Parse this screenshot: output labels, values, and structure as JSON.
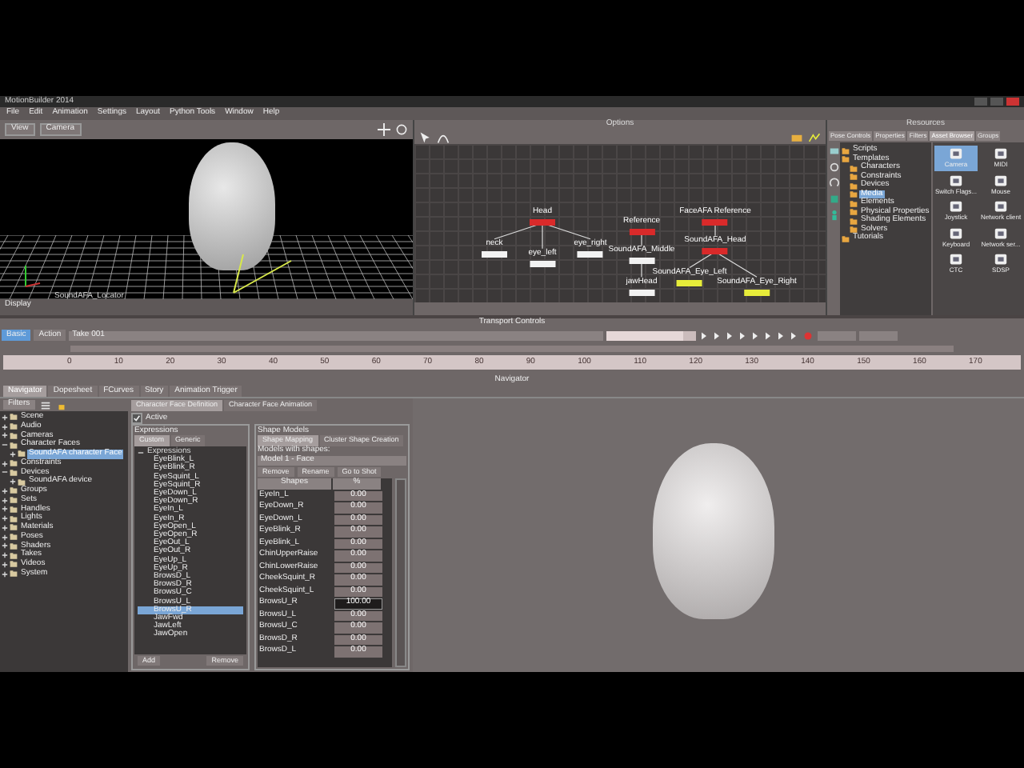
{
  "window": {
    "title": "MotionBuilder 2014"
  },
  "menu": [
    "File",
    "Edit",
    "Animation",
    "Settings",
    "Layout",
    "Python Tools",
    "Window",
    "Help"
  ],
  "viewer": {
    "buttons": [
      "View",
      "Camera"
    ],
    "object_label": "SoundAFA_Locator",
    "status": "Display"
  },
  "schematic": {
    "title": "Options",
    "nodes": [
      {
        "label": "Head",
        "kind": "red",
        "children": [
          {
            "label": "neck",
            "kind": "white"
          },
          {
            "label": "eye_left",
            "kind": "white"
          },
          {
            "label": "eye_right",
            "kind": "white"
          }
        ]
      },
      {
        "label": "Reference",
        "kind": "red",
        "children": [
          {
            "label": "SoundAFA_Middle",
            "kind": "white",
            "children": [
              {
                "label": "jawHead",
                "kind": "white"
              }
            ]
          }
        ]
      },
      {
        "label": "FaceAFA Reference",
        "kind": "red",
        "children": [
          {
            "label": "SoundAFA_Head",
            "kind": "red",
            "children": [
              {
                "label": "SoundAFA_Eye_Left",
                "kind": "yellow"
              },
              {
                "label": "SoundAFA_Eye_Right",
                "kind": "yellow"
              }
            ]
          }
        ]
      }
    ]
  },
  "resources": {
    "title": "Resources",
    "tabs": [
      {
        "label": "Pose Controls",
        "selected": false
      },
      {
        "label": "Properties",
        "selected": false
      },
      {
        "label": "Filters",
        "selected": false
      },
      {
        "label": "Asset Browser",
        "selected": true
      },
      {
        "label": "Groups",
        "selected": false
      }
    ],
    "tree": [
      {
        "label": "Scripts",
        "selected": false
      },
      {
        "label": "Templates",
        "selected": false,
        "children": [
          {
            "label": "Characters",
            "selected": false
          },
          {
            "label": "Constraints",
            "selected": false
          },
          {
            "label": "Devices",
            "selected": false
          },
          {
            "label": "Media",
            "selected": true
          },
          {
            "label": "Elements",
            "selected": false
          },
          {
            "label": "Physical Properties",
            "selected": false
          },
          {
            "label": "Shading Elements",
            "selected": false
          },
          {
            "label": "Solvers",
            "selected": false
          }
        ]
      },
      {
        "label": "Tutorials",
        "selected": false
      }
    ],
    "assets": [
      {
        "label": "Camera",
        "selected": true
      },
      {
        "label": "MIDI",
        "selected": false
      },
      {
        "label": "Switch Flags...",
        "selected": false
      },
      {
        "label": "Mouse",
        "selected": false
      },
      {
        "label": "Joystick",
        "selected": false
      },
      {
        "label": "Network client",
        "selected": false
      },
      {
        "label": "Keyboard",
        "selected": false
      },
      {
        "label": "Network ser...",
        "selected": false
      },
      {
        "label": "CTC",
        "selected": false
      },
      {
        "label": "SDSP",
        "selected": false
      }
    ]
  },
  "transport": {
    "title": "Transport Controls",
    "modes": [
      {
        "label": "Basic",
        "selected": true
      },
      {
        "label": "Action",
        "selected": false
      }
    ],
    "take": "Take 001",
    "speed": {
      "level": 0.85
    },
    "ruler": [
      "0",
      "10",
      "20",
      "30",
      "40",
      "50",
      "60",
      "70",
      "80",
      "90",
      "100",
      "110",
      "120",
      "130",
      "140",
      "150",
      "160",
      "170"
    ]
  },
  "navigator": {
    "title": "Navigator",
    "tabs": [
      {
        "label": "Navigator",
        "selected": true
      },
      {
        "label": "Dopesheet",
        "selected": false
      },
      {
        "label": "FCurves",
        "selected": false
      },
      {
        "label": "Story",
        "selected": false
      },
      {
        "label": "Animation Trigger",
        "selected": false
      }
    ],
    "filter": "Filters",
    "tree": [
      {
        "label": "Scene",
        "selected": false
      },
      {
        "label": "Audio",
        "selected": false
      },
      {
        "label": "Cameras",
        "selected": false
      },
      {
        "label": "Character Faces",
        "selected": false,
        "children": [
          {
            "label": "SoundAFA character Face",
            "selected": true
          }
        ]
      },
      {
        "label": "Constraints",
        "selected": false
      },
      {
        "label": "Devices",
        "selected": false,
        "children": [
          {
            "label": "SoundAFA device",
            "selected": false
          }
        ]
      },
      {
        "label": "Groups",
        "selected": false
      },
      {
        "label": "Sets",
        "selected": false
      },
      {
        "label": "Handles",
        "selected": false
      },
      {
        "label": "Lights",
        "selected": false
      },
      {
        "label": "Materials",
        "selected": false
      },
      {
        "label": "Poses",
        "selected": false
      },
      {
        "label": "Shaders",
        "selected": false
      },
      {
        "label": "Takes",
        "selected": false
      },
      {
        "label": "Videos",
        "selected": false
      },
      {
        "label": "System",
        "selected": false
      }
    ]
  },
  "face": {
    "tabs": [
      {
        "label": "Character Face Definition",
        "selected": true
      },
      {
        "label": "Character Face Animation",
        "selected": false
      }
    ],
    "active": {
      "label": "Active",
      "checked": true
    },
    "expressions": {
      "title": "Expressions",
      "tabs": [
        {
          "label": "Custom",
          "selected": true
        },
        {
          "label": "Generic",
          "selected": false
        }
      ],
      "heading": "Expressions",
      "items": [
        {
          "label": "EyeBlink_L",
          "selected": false
        },
        {
          "label": "EyeBlink_R",
          "selected": false
        },
        {
          "label": "EyeSquint_L",
          "selected": false
        },
        {
          "label": "EyeSquint_R",
          "selected": false
        },
        {
          "label": "EyeDown_L",
          "selected": false
        },
        {
          "label": "EyeDown_R",
          "selected": false
        },
        {
          "label": "EyeIn_L",
          "selected": false
        },
        {
          "label": "EyeIn_R",
          "selected": false
        },
        {
          "label": "EyeOpen_L",
          "selected": false
        },
        {
          "label": "EyeOpen_R",
          "selected": false
        },
        {
          "label": "EyeOut_L",
          "selected": false
        },
        {
          "label": "EyeOut_R",
          "selected": false
        },
        {
          "label": "EyeUp_L",
          "selected": false
        },
        {
          "label": "EyeUp_R",
          "selected": false
        },
        {
          "label": "BrowsD_L",
          "selected": false
        },
        {
          "label": "BrowsD_R",
          "selected": false
        },
        {
          "label": "BrowsU_C",
          "selected": false
        },
        {
          "label": "BrowsU_L",
          "selected": false
        },
        {
          "label": "BrowsU_R",
          "selected": true
        },
        {
          "label": "JawFwd",
          "selected": false
        },
        {
          "label": "JawLeft",
          "selected": false
        },
        {
          "label": "JawOpen",
          "selected": false
        }
      ],
      "buttons": [
        "Add",
        "Remove"
      ]
    },
    "shapes": {
      "title": "Shape Models",
      "tabs": [
        {
          "label": "Shape Mapping",
          "selected": true
        },
        {
          "label": "Cluster Shape Creation",
          "selected": false
        }
      ],
      "models_label": "Models with shapes:",
      "model": "Model 1 - Face",
      "buttons": [
        "Remove",
        "Rename",
        "Go to Shot"
      ],
      "columns": [
        "Shapes",
        "%"
      ],
      "rows": [
        {
          "name": "EyeIn_L",
          "value": "0.00",
          "selected": false
        },
        {
          "name": "EyeDown_R",
          "value": "0.00",
          "selected": false
        },
        {
          "name": "EyeDown_L",
          "value": "0.00",
          "selected": false
        },
        {
          "name": "EyeBlink_R",
          "value": "0.00",
          "selected": false
        },
        {
          "name": "EyeBlink_L",
          "value": "0.00",
          "selected": false
        },
        {
          "name": "ChinUpperRaise",
          "value": "0.00",
          "selected": false
        },
        {
          "name": "ChinLowerRaise",
          "value": "0.00",
          "selected": false
        },
        {
          "name": "CheekSquint_R",
          "value": "0.00",
          "selected": false
        },
        {
          "name": "CheekSquint_L",
          "value": "0.00",
          "selected": false
        },
        {
          "name": "BrowsU_R",
          "value": "100.00",
          "selected": true
        },
        {
          "name": "BrowsU_L",
          "value": "0.00",
          "selected": false
        },
        {
          "name": "BrowsU_C",
          "value": "0.00",
          "selected": false
        },
        {
          "name": "BrowsD_R",
          "value": "0.00",
          "selected": false
        },
        {
          "name": "BrowsD_L",
          "value": "0.00",
          "selected": false
        }
      ]
    }
  }
}
